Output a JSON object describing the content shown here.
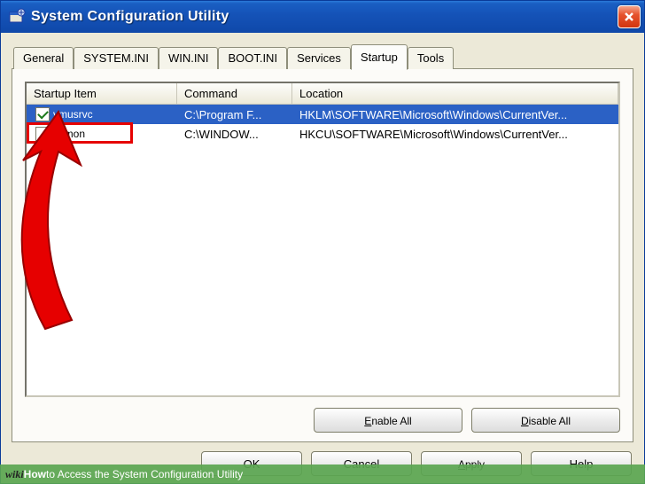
{
  "window": {
    "title": "System Configuration Utility"
  },
  "tabs": [
    "General",
    "SYSTEM.INI",
    "WIN.INI",
    "BOOT.INI",
    "Services",
    "Startup",
    "Tools"
  ],
  "active_tab_index": 5,
  "columns": [
    "Startup Item",
    "Command",
    "Location"
  ],
  "rows": [
    {
      "checked": true,
      "selected": true,
      "item": "vmusrvc",
      "command": "C:\\Program F...",
      "location": "HKLM\\SOFTWARE\\Microsoft\\Windows\\CurrentVer..."
    },
    {
      "checked": false,
      "selected": false,
      "item": "ctfmon",
      "command": "C:\\WINDOW...",
      "location": "HKCU\\SOFTWARE\\Microsoft\\Windows\\CurrentVer..."
    }
  ],
  "panel_buttons": {
    "enable_all": "Enable All",
    "disable_all": "Disable All"
  },
  "buttons": {
    "ok": "OK",
    "cancel": "Cancel",
    "apply": "Apply",
    "help": "Help"
  },
  "caption": {
    "brand": "wikiHow",
    "text": " to Access the System Configuration Utility"
  },
  "annotation": {
    "highlight_row": 1
  }
}
